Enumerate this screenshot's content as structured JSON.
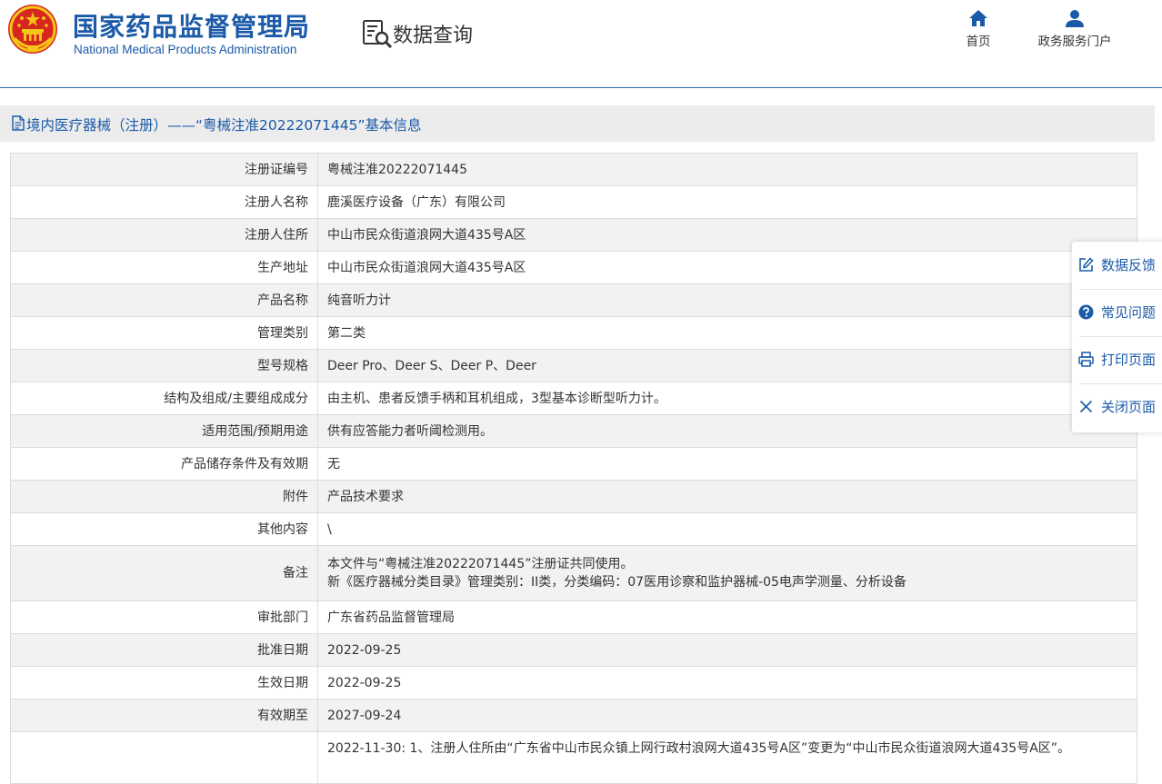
{
  "header": {
    "org_name_cn": "国家药品监督管理局",
    "org_name_en": "National Medical Products Administration",
    "query_title": "数据查询",
    "nav": [
      {
        "label": "首页",
        "icon": "home-icon"
      },
      {
        "label": "政务服务门户",
        "icon": "user-icon"
      }
    ]
  },
  "page_title": "境内医疗器械（注册）——“粤械注准20222071445”基本信息",
  "rows": [
    {
      "label": "注册证编号",
      "value": "粤械注准20222071445"
    },
    {
      "label": "注册人名称",
      "value": "鹿溪医疗设备（广东）有限公司"
    },
    {
      "label": "注册人住所",
      "value": "中山市民众街道浪网大道435号A区"
    },
    {
      "label": "生产地址",
      "value": "中山市民众街道浪网大道435号A区"
    },
    {
      "label": "产品名称",
      "value": "纯音听力计"
    },
    {
      "label": "管理类别",
      "value": "第二类"
    },
    {
      "label": "型号规格",
      "value": "Deer Pro、Deer S、Deer P、Deer"
    },
    {
      "label": "结构及组成/主要组成成分",
      "value": "由主机、患者反馈手柄和耳机组成，3型基本诊断型听力计。"
    },
    {
      "label": "适用范围/预期用途",
      "value": "供有应答能力者听阈检测用。"
    },
    {
      "label": "产品储存条件及有效期",
      "value": "无"
    },
    {
      "label": "附件",
      "value": "产品技术要求"
    },
    {
      "label": "其他内容",
      "value": "\\"
    }
  ],
  "remark": {
    "label": "备注",
    "line1": "本文件与“粤械注准20222071445”注册证共同使用。",
    "line2": "新《医疗器械分类目录》管理类别：II类，分类编码：07医用诊察和监护器械-05电声学测量、分析设备"
  },
  "rows2": [
    {
      "label": "审批部门",
      "value": "广东省药品监督管理局"
    },
    {
      "label": "批准日期",
      "value": "2022-09-25"
    },
    {
      "label": "生效日期",
      "value": "2022-09-25"
    },
    {
      "label": "有效期至",
      "value": "2027-09-24"
    }
  ],
  "change_history": {
    "label": "",
    "value": "2022-11-30: 1、注册人住所由“广东省中山市民众镇上网行政村浪网大道435号A区”变更为“中山市民众街道浪网大道435号A区”。"
  },
  "float_panel": [
    {
      "label": "数据反馈",
      "icon": "edit-icon"
    },
    {
      "label": "常见问题",
      "icon": "question-icon"
    },
    {
      "label": "打印页面",
      "icon": "print-icon"
    },
    {
      "label": "关闭页面",
      "icon": "close-icon"
    }
  ],
  "colors": {
    "brand_blue": "#1a5aa8",
    "emblem_red": "#d7261f",
    "emblem_gold": "#f5c518"
  }
}
